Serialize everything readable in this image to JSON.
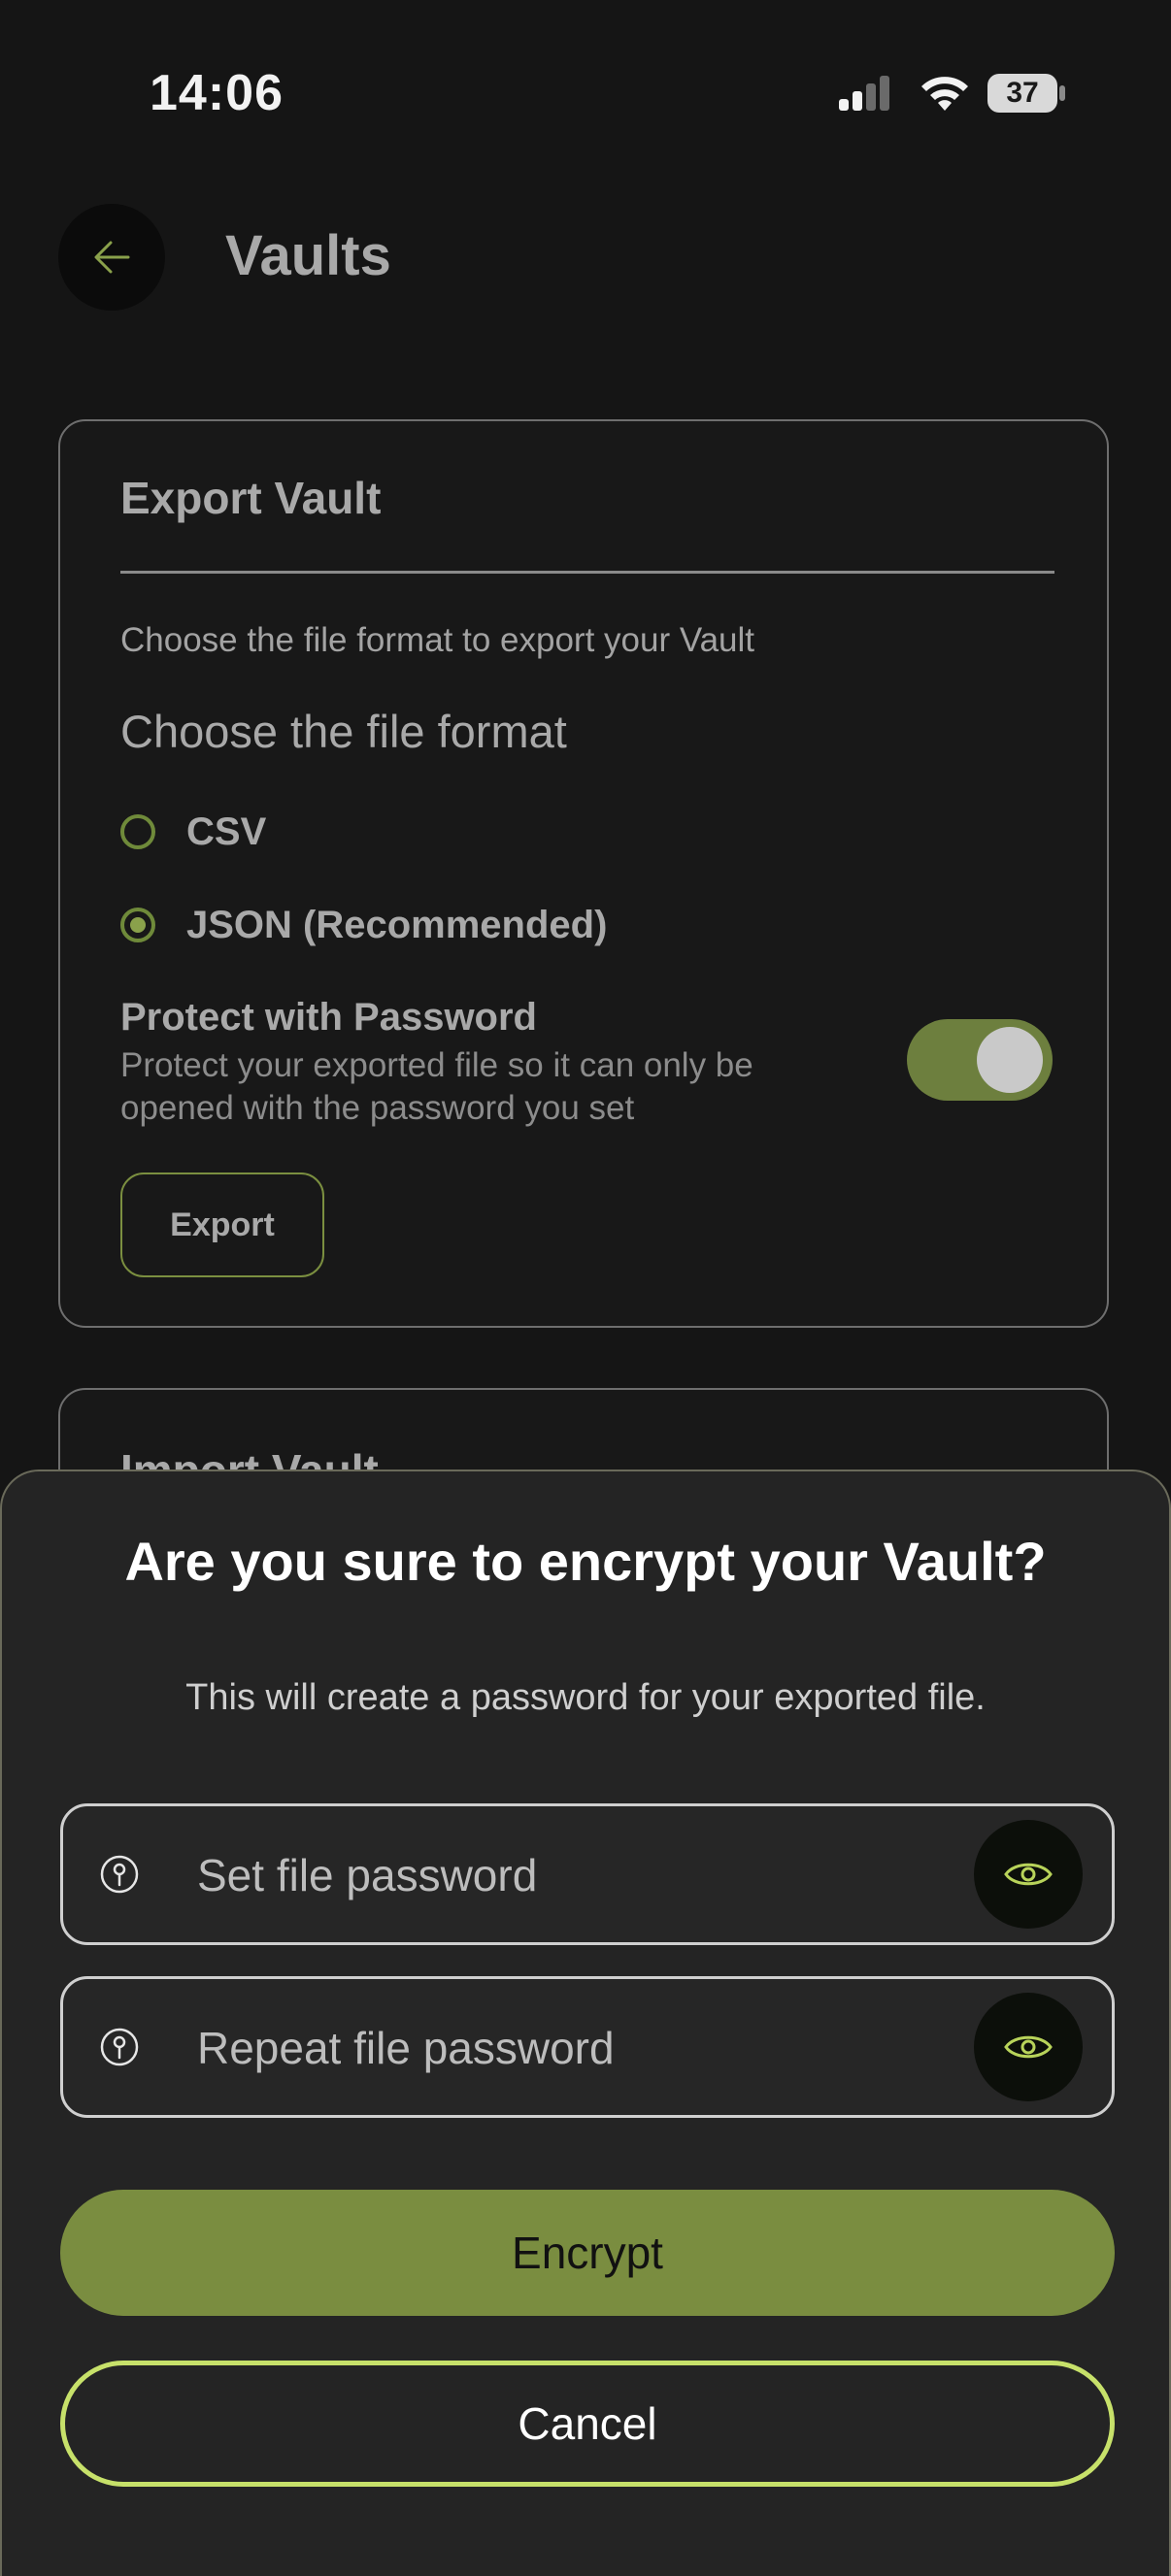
{
  "status_bar": {
    "time": "14:06",
    "battery": "37"
  },
  "header": {
    "title": "Vaults",
    "back_icon": "arrow-left-icon"
  },
  "export_card": {
    "title": "Export Vault",
    "description": "Choose the file format to export your Vault",
    "format_heading": "Choose the file format",
    "formats": [
      {
        "label": "CSV",
        "selected": false
      },
      {
        "label": "JSON (Recommended)",
        "selected": true
      }
    ],
    "protect": {
      "title": "Protect with Password",
      "description": "Protect your exported file so it can only be opened with the password you set",
      "enabled": true
    },
    "export_label": "Export"
  },
  "import_card": {
    "title": "Import Vault"
  },
  "sheet": {
    "title": "Are you sure to encrypt your Vault?",
    "description": "This will create a password for your exported file.",
    "password_placeholder": "Set file password",
    "repeat_placeholder": "Repeat file password",
    "encrypt_label": "Encrypt",
    "cancel_label": "Cancel"
  },
  "colors": {
    "accent": "#7a8d40",
    "accent_light": "#c7e16a",
    "background": "#151515"
  }
}
